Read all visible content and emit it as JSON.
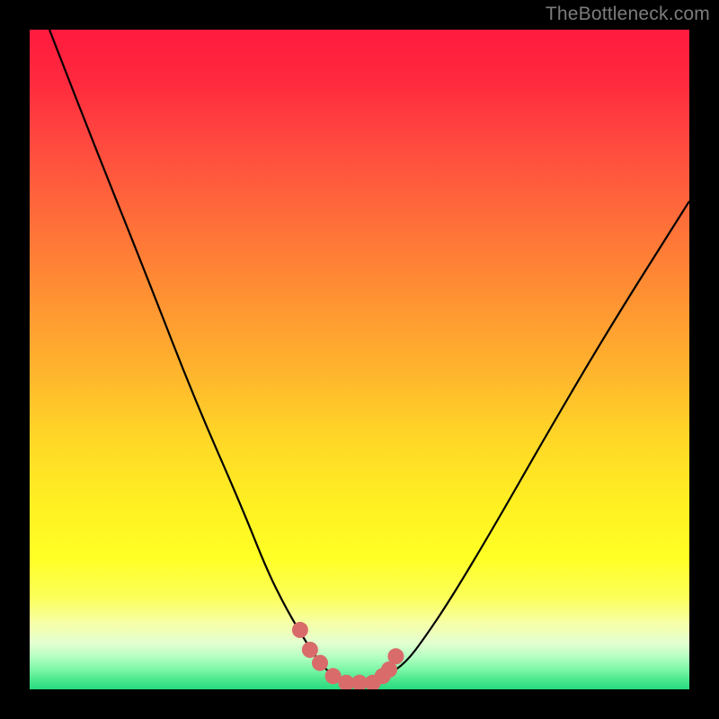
{
  "watermark": "TheBottleneck.com",
  "chart_data": {
    "type": "line",
    "title": "",
    "xlabel": "",
    "ylabel": "",
    "xlim": [
      0,
      100
    ],
    "ylim": [
      0,
      100
    ],
    "grid": false,
    "legend": false,
    "annotations": [],
    "series": [
      {
        "name": "curve",
        "color": "#000000",
        "x": [
          3,
          10,
          18,
          25,
          32,
          36,
          39,
          42,
          44,
          46,
          48,
          50,
          52,
          54,
          57,
          60,
          64,
          70,
          78,
          88,
          100
        ],
        "y": [
          100,
          82,
          62,
          44,
          28,
          18,
          12,
          7,
          4,
          2,
          1,
          1,
          1,
          2,
          4,
          8,
          14,
          24,
          38,
          55,
          74
        ]
      },
      {
        "name": "highlight-dots",
        "color": "#d96b6b",
        "x": [
          41,
          42.5,
          44,
          46,
          48,
          50,
          52,
          53.5,
          54.5,
          55.5
        ],
        "y": [
          9,
          6,
          4,
          2,
          1,
          1,
          1,
          2,
          3,
          5
        ]
      }
    ]
  }
}
